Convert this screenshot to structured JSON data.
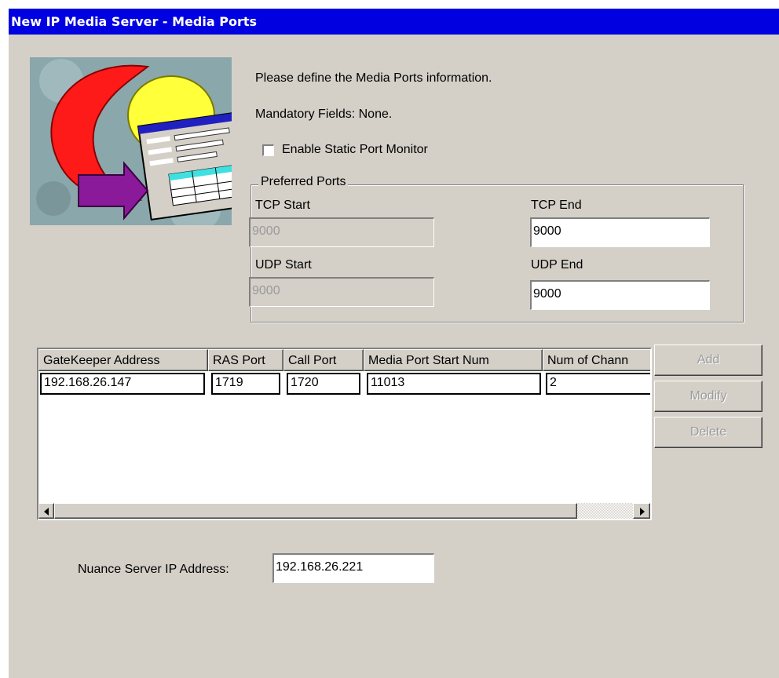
{
  "window": {
    "title": "New IP Media Server - Media Ports"
  },
  "intro": {
    "prompt": "Please define the Media Ports information.",
    "mandatory": "Mandatory Fields: None."
  },
  "static_monitor": {
    "label": "Enable Static Port Monitor",
    "checked": false
  },
  "preferred_ports": {
    "group_label": "Preferred Ports",
    "tcp_start": {
      "label": "TCP Start",
      "value": "9000",
      "enabled": false
    },
    "tcp_end": {
      "label": "TCP End",
      "value": "9000",
      "enabled": true
    },
    "udp_start": {
      "label": "UDP Start",
      "value": "9000",
      "enabled": false
    },
    "udp_end": {
      "label": "UDP End",
      "value": "9000",
      "enabled": true
    }
  },
  "gatekeeper_list": {
    "columns": [
      "GateKeeper Address",
      "RAS Port",
      "Call Port",
      "Media Port Start Num",
      "Num of Chann"
    ],
    "rows": [
      [
        "192.168.26.147",
        "1719",
        "1720",
        "11013",
        "2"
      ]
    ]
  },
  "buttons": {
    "add": "Add",
    "modify": "Modify",
    "delete": "Delete"
  },
  "nuance": {
    "label": "Nuance Server IP Address:",
    "value": "192.168.26.221"
  },
  "icons": {
    "scroll_left": "triangle-left-icon",
    "scroll_right": "triangle-right-icon",
    "logo": "wizard-logo"
  },
  "colors": {
    "titlebar": "#0000e0",
    "dialog_face": "#d4d0c8"
  }
}
